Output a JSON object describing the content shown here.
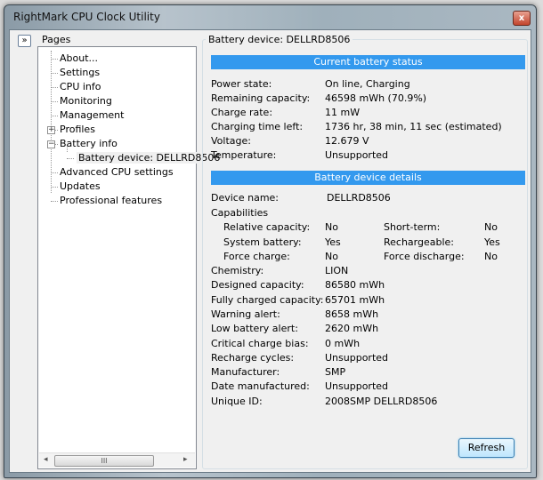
{
  "window": {
    "title": "RightMark CPU Clock Utility",
    "close": "x",
    "expand": "»"
  },
  "tree": {
    "label": "Pages",
    "items": [
      "About...",
      "Settings",
      "CPU info",
      "Monitoring",
      "Management",
      "Profiles",
      "Battery info",
      "Battery device:  DELLRD8506",
      "Advanced CPU settings",
      "Updates",
      "Professional features"
    ],
    "scroll_grip": "III",
    "scroll_left": "◂",
    "scroll_right": "▸"
  },
  "main": {
    "group_label": "Battery device:  DELLRD8506",
    "status_header": "Current battery status",
    "status": [
      [
        "Power state:",
        "On line, Charging"
      ],
      [
        "Remaining capacity:",
        "46598 mWh (70.9%)"
      ],
      [
        "Charge rate:",
        "11 mW"
      ],
      [
        "Charging time left:",
        "1736 hr, 38 min, 11 sec (estimated)"
      ],
      [
        "Voltage:",
        "12.679 V"
      ],
      [
        "Temperature:",
        "Unsupported"
      ]
    ],
    "details_header": "Battery device details",
    "device_name": [
      "Device name:",
      "DELLRD8506"
    ],
    "capabilities_label": "Capabilities",
    "capabilities": [
      [
        "Relative capacity:",
        "No",
        "Short-term:",
        "No"
      ],
      [
        "System battery:",
        "Yes",
        "Rechargeable:",
        "Yes"
      ],
      [
        "Force charge:",
        "No",
        "Force discharge:",
        "No"
      ]
    ],
    "details": [
      [
        "Chemistry:",
        "LION"
      ],
      [
        "Designed capacity:",
        "86580 mWh"
      ],
      [
        "Fully charged capacity:",
        "65701 mWh"
      ],
      [
        "Warning alert:",
        "8658 mWh"
      ],
      [
        "Low battery alert:",
        "2620 mWh"
      ],
      [
        "Critical charge bias:",
        "0 mWh"
      ],
      [
        "Recharge cycles:",
        "Unsupported"
      ],
      [
        "Manufacturer:",
        "SMP"
      ],
      [
        "Date manufactured:",
        "Unsupported"
      ],
      [
        "Unique ID:",
        "2008SMP DELLRD8506"
      ]
    ],
    "refresh": "Refresh"
  },
  "colors": {
    "header_bar": "#3399ee"
  }
}
